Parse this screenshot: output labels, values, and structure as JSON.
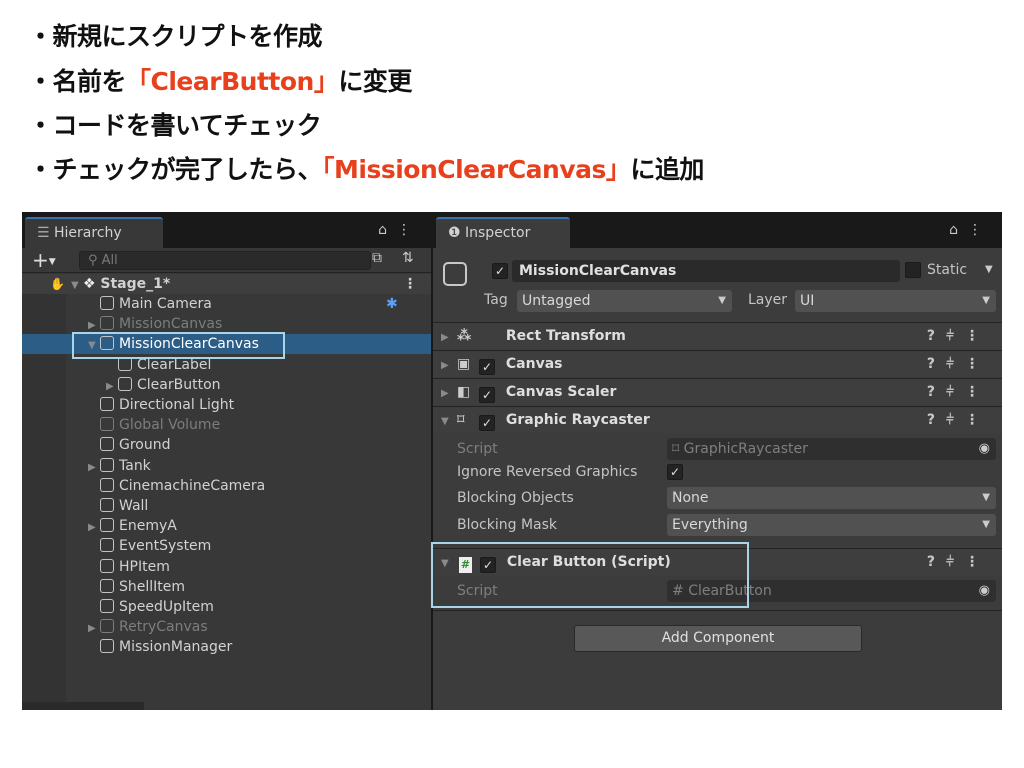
{
  "slide": {
    "bullets": [
      {
        "text": "・新規にスクリプトを作成"
      },
      {
        "pre": "・名前を",
        "red": "「ClearButton」",
        "post": "に変更"
      },
      {
        "text": "・コードを書いてチェック"
      },
      {
        "pre": "・チェックが完了したら、",
        "red": "「MissionClearCanvas」",
        "post": "に追加"
      }
    ],
    "accent": "#e8401c",
    "highlight_color": "#a8d6e8"
  },
  "hierarchy": {
    "tab": "Hierarchy",
    "search_placeholder": "All",
    "scene": "Stage_1*",
    "items": [
      {
        "label": "Main Camera",
        "depth": 1,
        "arrow": false,
        "dim": false
      },
      {
        "label": "MissionCanvas",
        "depth": 1,
        "arrow": true,
        "dim": true
      },
      {
        "label": "MissionClearCanvas",
        "depth": 1,
        "arrow": true,
        "open": true,
        "dim": false,
        "selected": true
      },
      {
        "label": "ClearLabel",
        "depth": 2,
        "arrow": false,
        "dim": false
      },
      {
        "label": "ClearButton",
        "depth": 2,
        "arrow": true,
        "dim": false
      },
      {
        "label": "Directional Light",
        "depth": 1,
        "arrow": false,
        "dim": false
      },
      {
        "label": "Global Volume",
        "depth": 1,
        "arrow": false,
        "dim": true
      },
      {
        "label": "Ground",
        "depth": 1,
        "arrow": false,
        "dim": false
      },
      {
        "label": "Tank",
        "depth": 1,
        "arrow": true,
        "dim": false
      },
      {
        "label": "CinemachineCamera",
        "depth": 1,
        "arrow": false,
        "dim": false
      },
      {
        "label": "Wall",
        "depth": 1,
        "arrow": false,
        "dim": false
      },
      {
        "label": "EnemyA",
        "depth": 1,
        "arrow": true,
        "dim": false
      },
      {
        "label": "EventSystem",
        "depth": 1,
        "arrow": false,
        "dim": false
      },
      {
        "label": "HPItem",
        "depth": 1,
        "arrow": false,
        "dim": false
      },
      {
        "label": "ShellItem",
        "depth": 1,
        "arrow": false,
        "dim": false
      },
      {
        "label": "SpeedUpItem",
        "depth": 1,
        "arrow": false,
        "dim": false
      },
      {
        "label": "RetryCanvas",
        "depth": 1,
        "arrow": true,
        "dim": true
      },
      {
        "label": "MissionManager",
        "depth": 1,
        "arrow": false,
        "dim": false
      }
    ],
    "selection_color": "#2c5d87"
  },
  "inspector": {
    "tab": "Inspector",
    "object_name": "MissionClearCanvas",
    "static_label": "Static",
    "tag_label": "Tag",
    "tag_value": "Untagged",
    "layer_label": "Layer",
    "layer_value": "UI",
    "components": [
      {
        "name": "Rect Transform",
        "checkbox": false
      },
      {
        "name": "Canvas",
        "checkbox": true
      },
      {
        "name": "Canvas Scaler",
        "checkbox": true
      },
      {
        "name": "Graphic Raycaster",
        "checkbox": true
      }
    ],
    "raycaster_props": {
      "script_label": "Script",
      "script_value": "GraphicRaycaster",
      "ignore_label": "Ignore Reversed Graphics",
      "ignore_checked": true,
      "blocking_objects_label": "Blocking Objects",
      "blocking_objects_value": "None",
      "blocking_mask_label": "Blocking Mask",
      "blocking_mask_value": "Everything"
    },
    "script_component": {
      "name": "Clear Button (Script)",
      "script_label": "Script",
      "script_value": "ClearButton"
    },
    "add_component": "Add Component"
  }
}
